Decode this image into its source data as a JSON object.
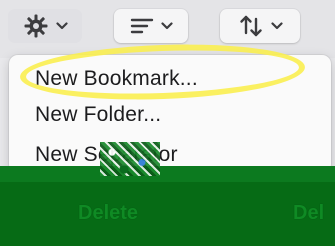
{
  "toolbar": {
    "buttons": [
      {
        "name": "actions",
        "icon": "gear-icon"
      },
      {
        "name": "sort",
        "icon": "list-filter-icon"
      },
      {
        "name": "organize",
        "icon": "sort-arrows-icon"
      }
    ]
  },
  "menu": {
    "items": [
      {
        "label": "New Bookmark..."
      },
      {
        "label": "New Folder..."
      },
      {
        "label": "New Separator"
      }
    ],
    "highlight_color": "#faee50"
  },
  "actionbar": {
    "buttons": [
      {
        "label": "Delete"
      },
      {
        "label": "Del"
      }
    ],
    "color": "#066b15"
  }
}
